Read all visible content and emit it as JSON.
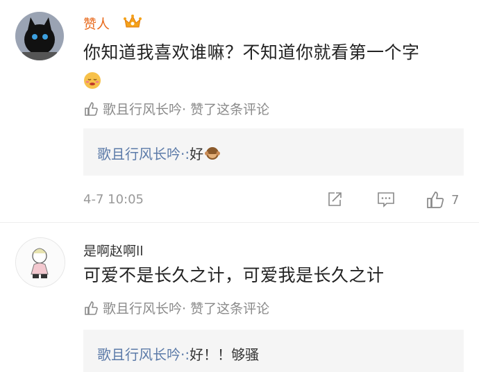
{
  "comments": [
    {
      "username": "赞人",
      "text": "你知道我喜欢谁嘛？不知道你就看第一个字",
      "liked_by_text": "歌且行风长吟· 赞了这条评论",
      "reply": {
        "author": "歌且行风长吟·:",
        "text": " 好"
      },
      "time": "4-7 10:05",
      "like_count": "7"
    },
    {
      "username": "是啊赵啊ll",
      "text": "可爱不是长久之计，可爱我是长久之计",
      "liked_by_text": "歌且行风长吟· 赞了这条评论",
      "reply": {
        "author": "歌且行风长吟·:",
        "text": " 好！！够骚"
      }
    }
  ],
  "icons": {
    "crown": "crown-icon",
    "thumb": "thumbs-up-icon",
    "share": "share-icon",
    "comment": "comment-icon",
    "emoji": "smile-emoji-icon",
    "monkey": "monkey-emoji-icon"
  },
  "colors": {
    "vip_name": "#e86a1c",
    "reply_author": "#5b7aa8",
    "muted": "#8a8a8a"
  }
}
